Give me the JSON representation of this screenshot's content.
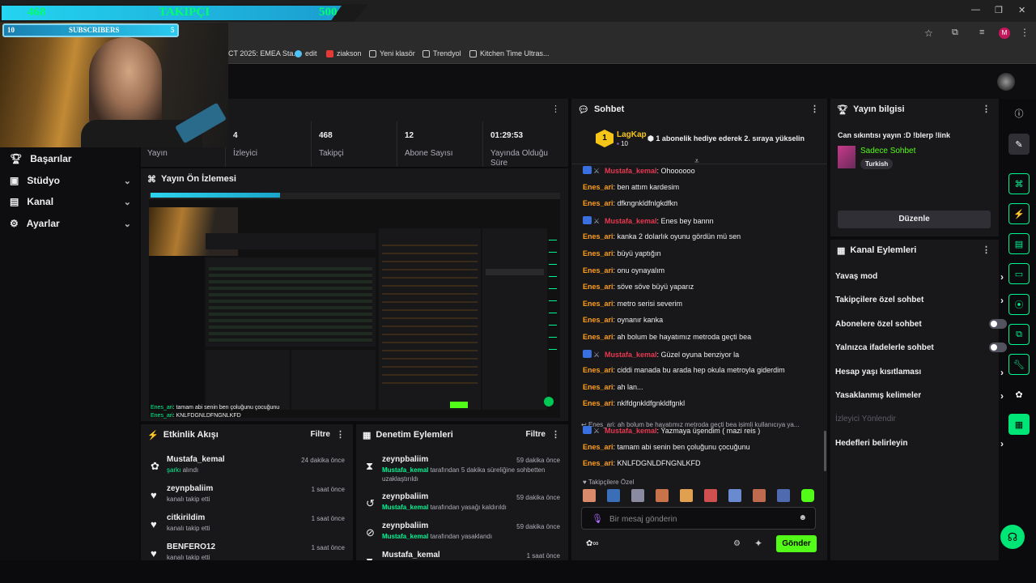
{
  "overlay": {
    "followers_current": "468",
    "followers_label": "TAKIPÇI",
    "followers_goal": "500",
    "subs_current": "10",
    "subs_label": "SUBSCRIBERS",
    "subs_goal": "5"
  },
  "browser": {
    "bookmarks": [
      {
        "label": "CT 2025: EMEA Sta...",
        "color": "#7a7a7a"
      },
      {
        "label": "edit",
        "color": "#4fc3f7"
      },
      {
        "label": "ziakson",
        "color": "#e53935"
      },
      {
        "label": "Yeni klasör",
        "color": "#cfcfcf"
      },
      {
        "label": "Trendyol",
        "color": "#cfcfcf"
      },
      {
        "label": "Kitchen Time Ultras...",
        "color": "#cfcfcf"
      }
    ],
    "profile_initial": "M"
  },
  "nav": {
    "items": [
      {
        "label": "Başarılar"
      },
      {
        "label": "Stüdyo"
      },
      {
        "label": "Kanal"
      },
      {
        "label": "Ayarlar"
      }
    ]
  },
  "stats": [
    {
      "value": "",
      "label": "Yayın"
    },
    {
      "value": "4",
      "label": "İzleyici"
    },
    {
      "value": "468",
      "label": "Takipçi"
    },
    {
      "value": "12",
      "label": "Abone Sayısı"
    },
    {
      "value": "01:29:53",
      "label": "Yayında Olduğu Süre"
    }
  ],
  "preview": {
    "title": "Yayın Ön İzlemesi",
    "chat_line1_user": "Enes_ari",
    "chat_line1_text": ": tamam abi senin ben çoluğunu çocuğunu",
    "chat_line2_user": "Enes_ari",
    "chat_line2_text": ": KNLFDGNLDFNGNLKFD"
  },
  "activity": {
    "title": "Etkinlik Akışı",
    "filter": "Filtre",
    "rows": [
      {
        "icon": "gift-icon",
        "name": "Mustafa_kemal",
        "sub": "şarkı",
        "sub2": " alındı",
        "time": "24 dakika önce"
      },
      {
        "icon": "heart-icon",
        "name": "zeynpbaliim",
        "sub": "",
        "sub2": "kanalı takip etti",
        "time": "1 saat önce"
      },
      {
        "icon": "heart-icon",
        "name": "citkirildim",
        "sub": "",
        "sub2": "kanalı takip etti",
        "time": "1 saat önce"
      },
      {
        "icon": "heart-icon",
        "name": "BENFERO12",
        "sub": "",
        "sub2": "kanalı takip etti",
        "time": "1 saat önce"
      }
    ]
  },
  "moderation": {
    "title": "Denetim Eylemleri",
    "filter": "Filtre",
    "rows": [
      {
        "name": "zeynpbaliim",
        "actor": "Mustafa_kemal",
        "text": " tarafından 5 dakika süreliğine sohbetten",
        "text2": "uzaklaştırıldı",
        "time": "59 dakika önce"
      },
      {
        "name": "zeynpbaliim",
        "actor": "Mustafa_kemal",
        "text": " tarafından yasağı kaldırıldı",
        "text2": "",
        "time": "59 dakika önce"
      },
      {
        "name": "zeynpbaliim",
        "actor": "Mustafa_kemal",
        "text": " tarafından yasaklandı",
        "text2": "",
        "time": "59 dakika önce"
      },
      {
        "name": "Mustafa_kemal",
        "actor": "",
        "text": "",
        "text2": "",
        "time": "1 saat önce"
      }
    ]
  },
  "chat": {
    "title": "Sohbet",
    "pinned_user": "LagKap",
    "pinned_count": "10",
    "pinned_text": "1 abonelik hediye ederek 2. sıraya yükselin",
    "messages": [
      {
        "user": "Mustafa_kemal",
        "text": ": Ohoooooo",
        "mod": true
      },
      {
        "user": "Enes_ari",
        "text": ": ben attım kardesim",
        "mod": false
      },
      {
        "user": "Enes_ari",
        "text": ": dfkngnkldfnlgkdfkn",
        "mod": false
      },
      {
        "user": "Mustafa_kemal",
        "text": ": Enes bey bannn",
        "mod": true
      },
      {
        "user": "Enes_ari",
        "text": ": kanka 2 dolarlık oyunu gördün mü sen",
        "mod": false
      },
      {
        "user": "Enes_ari",
        "text": ": büyü yaptığın",
        "mod": false
      },
      {
        "user": "Enes_ari",
        "text": ": onu oynayalım",
        "mod": false
      },
      {
        "user": "Enes_ari",
        "text": ": söve söve büyü yaparız",
        "mod": false
      },
      {
        "user": "Enes_ari",
        "text": ": metro serisi severim",
        "mod": false
      },
      {
        "user": "Enes_ari",
        "text": ": oynanır kanka",
        "mod": false
      },
      {
        "user": "Enes_ari",
        "text": ": ah bolum be hayatımız metroda geçti bea",
        "mod": false
      },
      {
        "user": "Mustafa_kemal",
        "text": ": Güzel oyuna benziyor la",
        "mod": true
      },
      {
        "user": "Enes_ari",
        "text": ": ciddi manada bu arada hep okula metroyla giderdim",
        "mod": false
      },
      {
        "user": "Enes_ari",
        "text": ": ah lan...",
        "mod": false
      },
      {
        "user": "Enes_ari",
        "text": ": nklfdgnkldfgnkldfgnkl",
        "mod": false
      }
    ],
    "reply_preview": "Enes_ari: ah bolum be hayatımız metroda geçti bea isimli kullanıcıya yа...",
    "messages2": [
      {
        "user": "Mustafa_kemal",
        "text": ": Yazmaya üşendim ( mazi reis )",
        "mod": true
      },
      {
        "user": "Enes_ari",
        "text": ": tamam abi senin ben çoluğunu çocuğunu",
        "mod": false
      },
      {
        "user": "Enes_ari",
        "text": ": KNLFDGNLDFNGNLKFD",
        "mod": false
      }
    ],
    "followers_only": "Takipçilere Özel",
    "input_placeholder": "Bir mesaj gönderin",
    "send_label": "Gönder"
  },
  "stream_info": {
    "title": "Yayın bilgisi",
    "stream_title": "Can sıkıntısı yayın :D !blerp !link",
    "category": "Sadece Sohbet",
    "tag": "Turkish",
    "edit_label": "Düzenle"
  },
  "channel_actions": {
    "title": "Kanal Eylemleri",
    "items": [
      {
        "label": "Yavaş mod",
        "kind": "arrow"
      },
      {
        "label": "Takipçilere özel sohbet",
        "kind": "arrow"
      },
      {
        "label": "Abonelere özel sohbet",
        "kind": "toggle"
      },
      {
        "label": "Yalnızca ifadelerle sohbet",
        "kind": "toggle"
      },
      {
        "label": "Hesap yaşı kısıtlaması",
        "kind": "arrow"
      },
      {
        "label": "Yasaklanmış kelimeler",
        "kind": "arrow"
      },
      {
        "label": "İzleyici Yönlendir",
        "kind": "disabled"
      },
      {
        "label": "Hedefleri belirleyin",
        "kind": "arrow"
      }
    ]
  },
  "colors": {
    "accent": "#00f593",
    "send_button": "#53fc18",
    "mod_name": "#e8384f",
    "user_name": "#ff9f1a"
  }
}
